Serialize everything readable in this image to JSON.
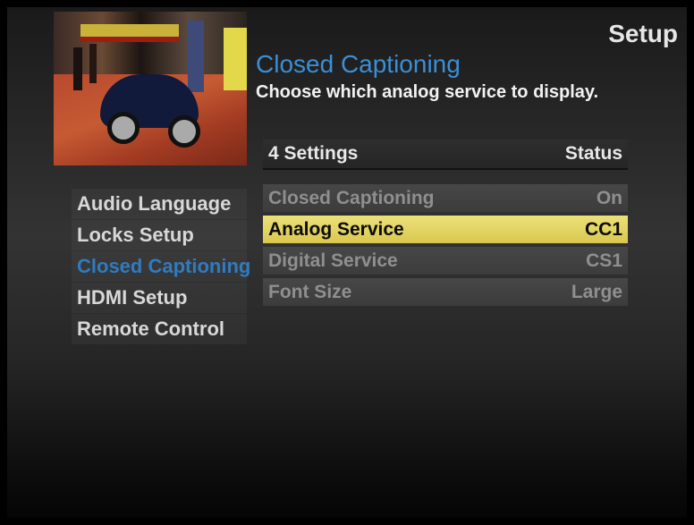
{
  "header": {
    "screen_title": "Setup",
    "section_title": "Closed Captioning",
    "instruction": "Choose which analog service to display."
  },
  "preview": {
    "description_icon": "video-preview"
  },
  "left_menu": {
    "items": [
      {
        "label": "Audio Language",
        "active": false
      },
      {
        "label": "Locks Setup",
        "active": false
      },
      {
        "label": "Closed Captioning",
        "active": true
      },
      {
        "label": "HDMI Setup",
        "active": false
      },
      {
        "label": "Remote Control",
        "active": false
      }
    ]
  },
  "settings": {
    "count_label": "4 Settings",
    "status_label": "Status",
    "rows": [
      {
        "label": "Closed Captioning",
        "value": "On",
        "selected": false
      },
      {
        "label": "Analog Service",
        "value": "CC1",
        "selected": true
      },
      {
        "label": "Digital Service",
        "value": "CS1",
        "selected": false
      },
      {
        "label": "Font Size",
        "value": "Large",
        "selected": false
      }
    ]
  },
  "colors": {
    "highlight": "#d9c84f",
    "active_menu": "#2f7bc2",
    "section_title": "#3a8fd6"
  }
}
